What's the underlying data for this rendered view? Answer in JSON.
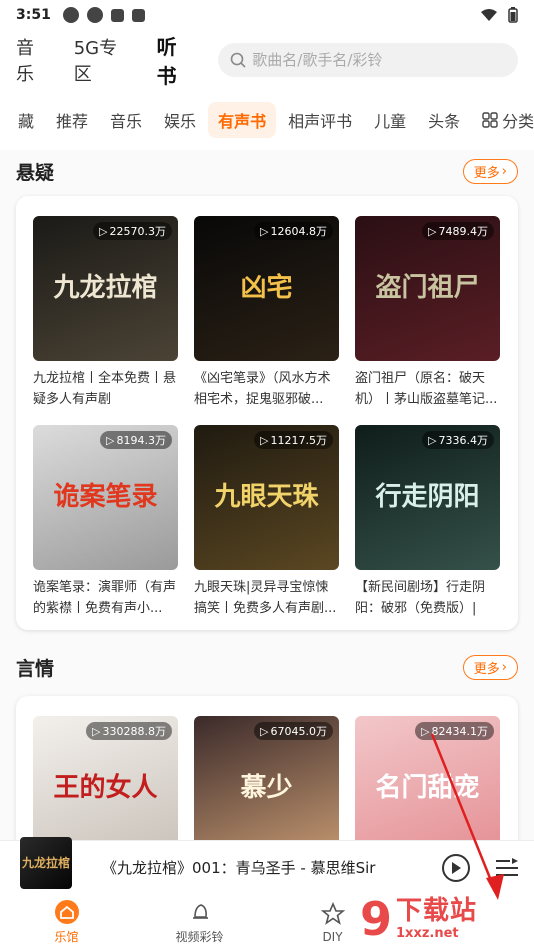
{
  "status": {
    "time": "3:51"
  },
  "topnav": {
    "tabs": [
      {
        "label": "音乐"
      },
      {
        "label": "5G专区"
      },
      {
        "label": "听书"
      }
    ],
    "search_placeholder": "歌曲名/歌手名/彩铃"
  },
  "categories": {
    "items": [
      "藏",
      "推荐",
      "音乐",
      "娱乐",
      "有声书",
      "相声评书",
      "儿童",
      "头条"
    ],
    "active": "有声书",
    "fenlei": "分类"
  },
  "sections": [
    {
      "title": "悬疑",
      "more": "更多",
      "books": [
        {
          "plays": "22570.3万",
          "cover_text": "九龙拉棺",
          "desc": "九龙拉棺丨全本免费丨悬疑多人有声剧",
          "colors": [
            "#1b1a17",
            "#4b4335"
          ],
          "text_color": "#efe6d2"
        },
        {
          "plays": "12604.8万",
          "cover_text": "凶宅",
          "desc": "《凶宅笔录》（风水方术相宅术，捉鬼驱邪破...",
          "colors": [
            "#080808",
            "#2b2116"
          ],
          "text_color": "#f3c04a"
        },
        {
          "plays": "7489.4万",
          "cover_text": "盗门祖尸",
          "desc": "盗门祖尸（原名：破天机）丨茅山版盗墓笔记...",
          "colors": [
            "#2a0f14",
            "#5a1e25"
          ],
          "text_color": "#c9c4a0"
        },
        {
          "plays": "8194.3万",
          "cover_text": "诡案笔录",
          "desc": "诡案笔录：演罪师（有声的紫襟丨免费有声小...",
          "colors": [
            "#dcdcdc",
            "#9a9a9a"
          ],
          "text_color": "#e0381e"
        },
        {
          "plays": "11217.5万",
          "cover_text": "九眼天珠",
          "desc": "九眼天珠|灵异寻宝惊悚搞笑丨免费多人有声剧...",
          "colors": [
            "#1f1a10",
            "#5b4722"
          ],
          "text_color": "#f2d36a"
        },
        {
          "plays": "7336.4万",
          "cover_text": "行走阴阳",
          "desc": "【新民间剧场】行走阴阳：破邪（免费版）|悬...",
          "colors": [
            "#0f1d1a",
            "#35514a"
          ],
          "text_color": "#d9efe9"
        }
      ]
    },
    {
      "title": "言情",
      "more": "更多",
      "books": [
        {
          "plays": "330288.8万",
          "cover_text": "王的女人",
          "desc": "",
          "colors": [
            "#f3f0ec",
            "#c8c0b8"
          ],
          "text_color": "#c21e1e"
        },
        {
          "plays": "67045.0万",
          "cover_text": "慕少",
          "desc": "",
          "colors": [
            "#3b2a2a",
            "#c79a72"
          ],
          "text_color": "#fff4dd"
        },
        {
          "plays": "82434.1万",
          "cover_text": "名门甜宠",
          "desc": "",
          "colors": [
            "#f2c7c9",
            "#e48e93"
          ],
          "text_color": "#ffffff"
        }
      ]
    }
  ],
  "player": {
    "title": "《九龙拉棺》001：青乌圣手 - 慕思维Sir",
    "cover_text": "九龙拉棺"
  },
  "bottomnav": [
    {
      "label": "乐馆",
      "icon": "home-icon",
      "active": true
    },
    {
      "label": "视频彩铃",
      "icon": "bell-icon",
      "active": false
    },
    {
      "label": "DIY",
      "icon": "star-icon",
      "active": false
    }
  ],
  "watermark": {
    "number": "9",
    "text": "下载站",
    "domain": "1xxz.net"
  }
}
